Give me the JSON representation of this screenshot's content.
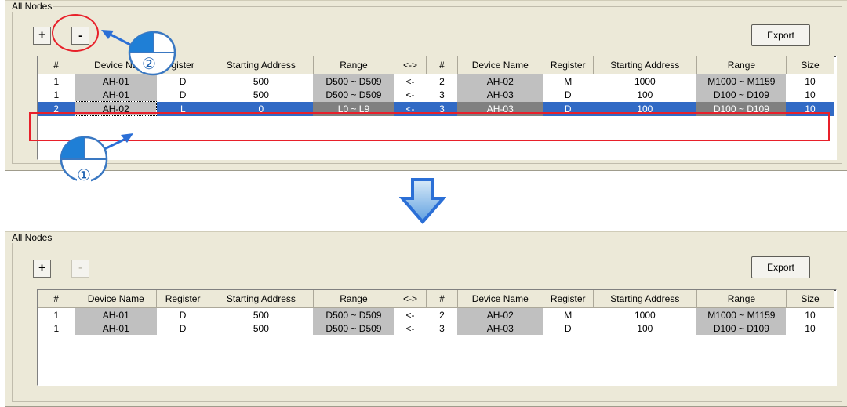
{
  "group_title": "All Nodes",
  "buttons": {
    "add": "+",
    "remove": "-",
    "export": "Export"
  },
  "columns": [
    "#",
    "Device Name",
    "Register",
    "Starting Address",
    "Range",
    "<->",
    "#",
    "Device Name",
    "Register",
    "Starting Address",
    "Range",
    "Size"
  ],
  "columns_top": [
    "#",
    "Device Na",
    "gister",
    "Starting Address",
    "Range",
    "<->",
    "#",
    "Device Name",
    "Register",
    "Starting Address",
    "Range",
    "Size"
  ],
  "before": {
    "rows": [
      [
        "1",
        "AH-01",
        "D",
        "500",
        "D500 ~ D509",
        "<-",
        "2",
        "AH-02",
        "M",
        "1000",
        "M1000 ~ M1159",
        "10"
      ],
      [
        "1",
        "AH-01",
        "D",
        "500",
        "D500 ~ D509",
        "<-",
        "3",
        "AH-03",
        "D",
        "100",
        "D100 ~ D109",
        "10"
      ],
      [
        "2",
        "AH-02",
        "L",
        "0",
        "L0 ~ L9",
        "<-",
        "3",
        "AH-03",
        "D",
        "100",
        "D100 ~ D109",
        "10"
      ]
    ],
    "selected_row": 2
  },
  "after": {
    "rows": [
      [
        "1",
        "AH-01",
        "D",
        "500",
        "D500 ~ D509",
        "<-",
        "2",
        "AH-02",
        "M",
        "1000",
        "M1000 ~ M1159",
        "10"
      ],
      [
        "1",
        "AH-01",
        "D",
        "500",
        "D500 ~ D509",
        "<-",
        "3",
        "AH-03",
        "D",
        "100",
        "D100 ~ D109",
        "10"
      ]
    ]
  },
  "annotations": {
    "step1": "①",
    "step2": "②"
  },
  "colors": {
    "highlight": "#e8202a",
    "selection": "#316ac5",
    "arrow": "#2b6fd6",
    "gray_cell": "#c0c0c0",
    "panel": "#ece9d8"
  },
  "icons": {
    "mouse": "mouse-icon",
    "down_arrow": "down-arrow-icon"
  }
}
